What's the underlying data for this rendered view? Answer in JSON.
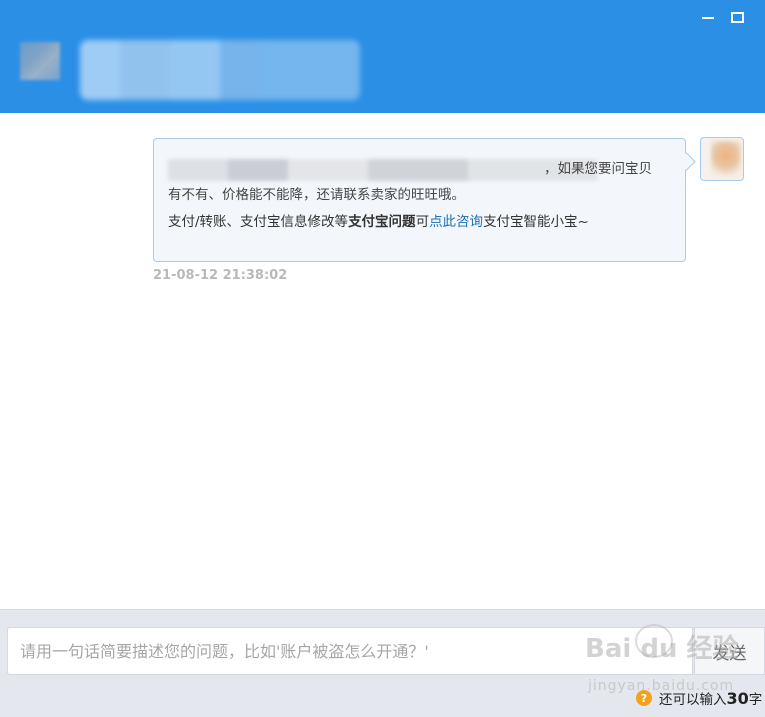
{
  "header": {
    "minimize_icon": "minimize-icon",
    "maximize_icon": "maximize-icon"
  },
  "message": {
    "line1_tail": "，如果您要问宝贝",
    "line2": "有不有、价格能不能降，还请联系卖家的旺旺哦。",
    "line3_prefix": "支付/转账、支付宝信息修改等",
    "line3_bold": "支付宝问题",
    "line3_mid": "可",
    "line3_link": "点此咨询",
    "line3_suffix": "支付宝智能小宝~",
    "timestamp": "21-08-12 21:38:02"
  },
  "composer": {
    "placeholder": "请用一句话简要描述您的问题，比如'账户被盗怎么开通？'",
    "send_label": "发送",
    "hint_prefix": "还可以输入",
    "hint_count": "30",
    "hint_suffix": "字",
    "hint_icon": "question-icon"
  },
  "watermark": {
    "logo": "Bai du 经验",
    "url": "jingyan.baidu.com"
  },
  "colors": {
    "header": "#2b8fe6",
    "link": "#1f6fb8",
    "bubble_border": "#a9cbe9",
    "hint_icon": "#f3a21b"
  }
}
